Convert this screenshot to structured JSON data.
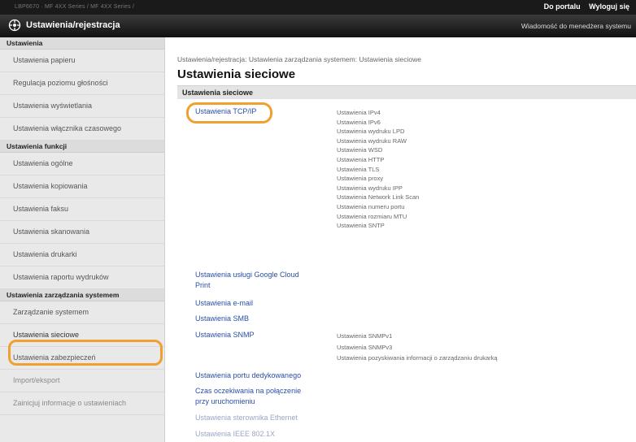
{
  "topbar": {
    "device": "LBP6670 · MF 4XX Series / MF 4XX Series /",
    "portal": "Do portalu",
    "logout": "Wyloguj się"
  },
  "header": {
    "title": "Ustawienia/rejestracja",
    "message": "Wiadomość do menedżera systemu"
  },
  "sidebar": {
    "sec1": "Ustawienia",
    "items1": [
      "Ustawienia papieru",
      "Regulacja poziomu głośności",
      "Ustawienia wyświetlania",
      "Ustawienia włącznika czasowego"
    ],
    "sec2": "Ustawienia funkcji",
    "items2": [
      "Ustawienia ogólne",
      "Ustawienia kopiowania",
      "Ustawienia faksu",
      "Ustawienia skanowania",
      "Ustawienia drukarki",
      "Ustawienia raportu wydruków"
    ],
    "sec3": "Ustawienia zarządzania systemem",
    "items3": [
      "Zarządzanie systemem",
      "Ustawienia sieciowe",
      "Ustawienia zabezpieczeń",
      "Import/eksport",
      "Zainicjuj informacje o ustawieniach"
    ]
  },
  "main": {
    "breadcrumb": "Ustawienia/rejestracja: Ustawienia zarządzania systemem: Ustawienia sieciowe",
    "title": "Ustawienia sieciowe",
    "section": "Ustawienia sieciowe",
    "tcpip": "Ustawienia TCP/IP",
    "tcpip_subs": [
      "Ustawienia IPv4",
      "Ustawienia IPv6",
      "Ustawienia wydruku LPD",
      "Ustawienia wydruku RAW",
      "Ustawienia WSD",
      "Ustawienia HTTP",
      "Ustawienia TLS",
      "Ustawienia proxy",
      "Ustawienia wydruku IPP",
      "Ustawienia Network Link Scan",
      "Ustawienia numeru portu",
      "Ustawienia rozmiaru MTU",
      "Ustawienia SNTP"
    ],
    "gcp_line1": "Ustawienia usługi Google Cloud",
    "gcp_line2": "Print",
    "email": "Ustawienia e-mail",
    "smb": "Ustawienia SMB",
    "snmp": "Ustawienia SNMP",
    "snmp_subs": [
      "Ustawienia SNMPv1",
      "Ustawienia SNMPv3",
      "Ustawienia pozyskiwania informacji o zarządzaniu drukarką"
    ],
    "dedicated_port": "Ustawienia portu dedykowanego",
    "wait_line1": "Czas oczekiwania na połączenie",
    "wait_line2": "przy uruchomieniu",
    "ethernet": "Ustawienia sterownika Ethernet",
    "ieee": "Ustawienia IEEE 802.1X"
  }
}
